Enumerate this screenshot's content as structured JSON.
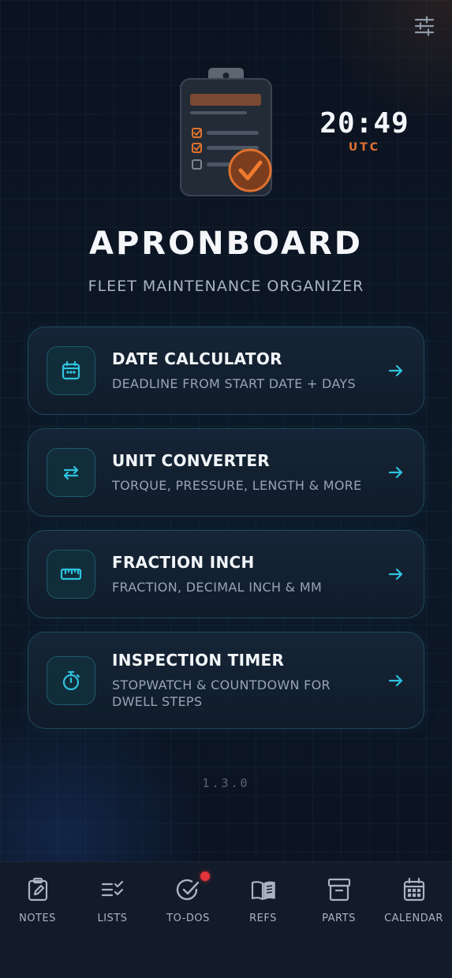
{
  "header": {
    "settings_icon": "sliders-icon",
    "clock": {
      "time": "20:49",
      "zone": "UTC"
    }
  },
  "app": {
    "title": "APRONBOARD",
    "subtitle": "FLEET MAINTENANCE ORGANIZER",
    "version": "1.3.0"
  },
  "tools": [
    {
      "title": "DATE CALCULATOR",
      "description": "DEADLINE FROM START DATE + DAYS",
      "icon": "calendar-icon"
    },
    {
      "title": "UNIT CONVERTER",
      "description": "TORQUE, PRESSURE, LENGTH & MORE",
      "icon": "swap-arrows-icon"
    },
    {
      "title": "FRACTION INCH",
      "description": "FRACTION, DECIMAL INCH & MM",
      "icon": "ruler-icon"
    },
    {
      "title": "INSPECTION TIMER",
      "description": "STOPWATCH & COUNTDOWN FOR DWELL STEPS",
      "icon": "stopwatch-icon"
    }
  ],
  "nav": [
    {
      "label": "NOTES",
      "icon": "notes-icon"
    },
    {
      "label": "LISTS",
      "icon": "checklist-icon"
    },
    {
      "label": "TO-DOS",
      "icon": "check-circle-icon",
      "has_badge": true
    },
    {
      "label": "REFS",
      "icon": "book-icon"
    },
    {
      "label": "PARTS",
      "icon": "archive-box-icon"
    },
    {
      "label": "CALENDAR",
      "icon": "calendar-icon"
    }
  ],
  "colors": {
    "accent": "#2fc3e0",
    "brand_orange": "#e0722e",
    "background": "#0b1220",
    "badge": "#e5333a"
  }
}
